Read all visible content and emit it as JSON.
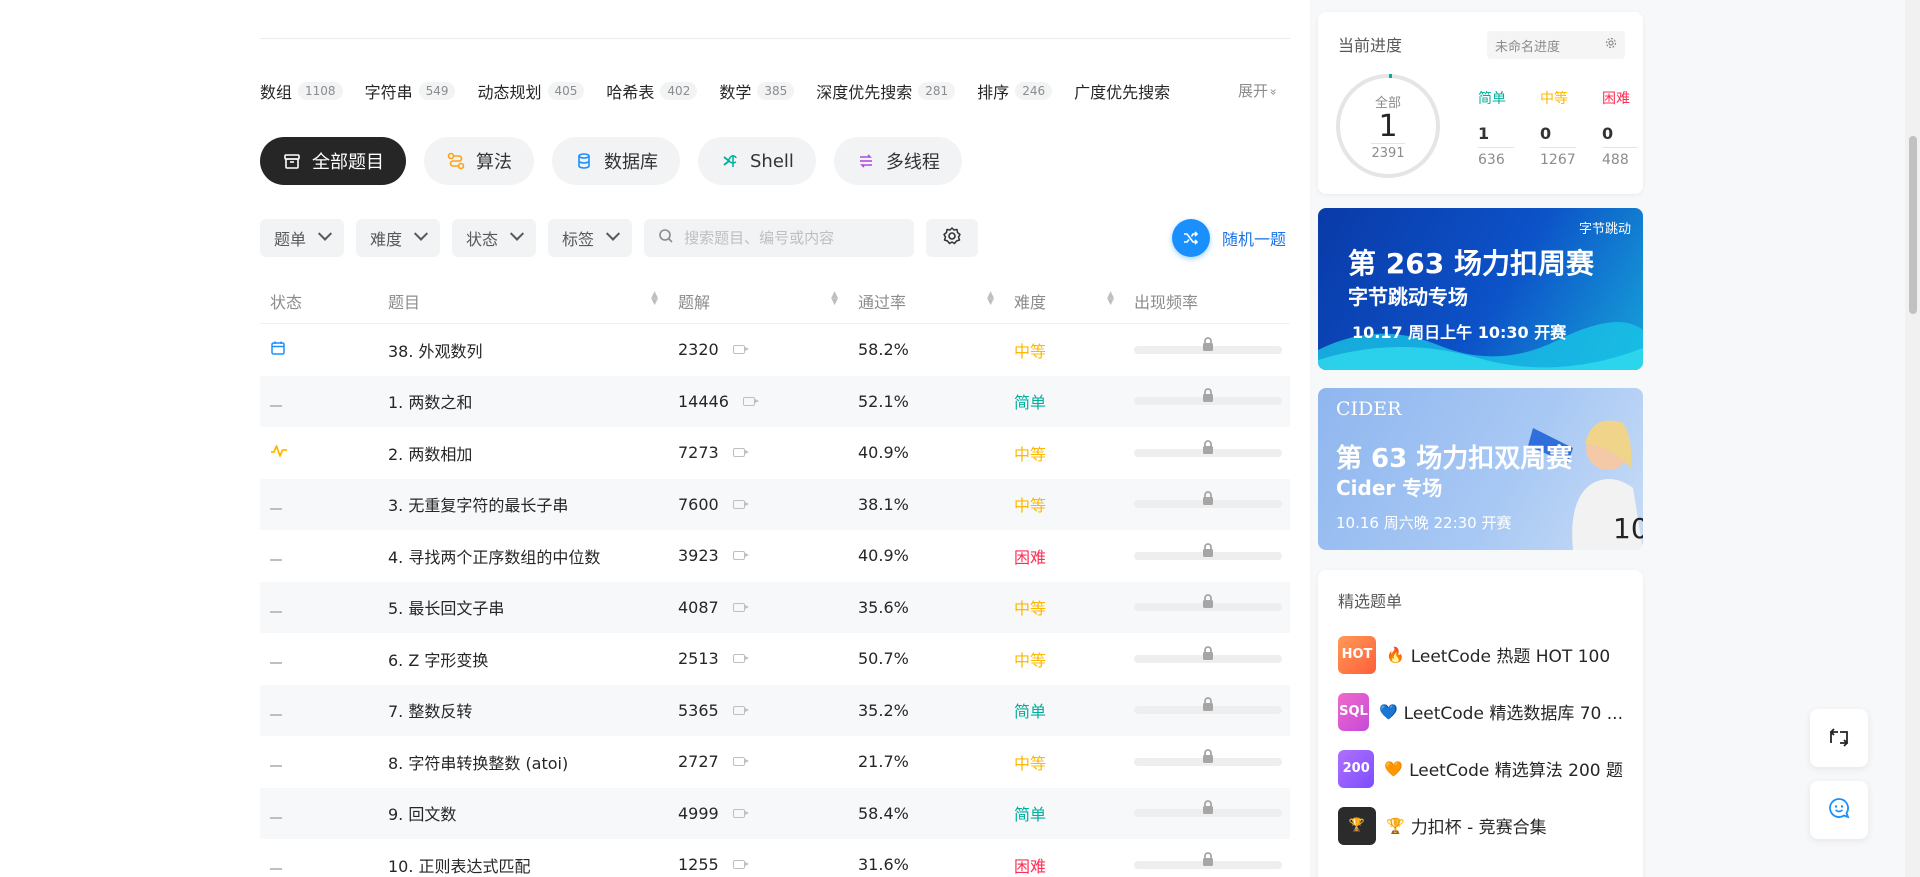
{
  "tags": [
    {
      "name": "数组",
      "count": "1108"
    },
    {
      "name": "字符串",
      "count": "549"
    },
    {
      "name": "动态规划",
      "count": "405"
    },
    {
      "name": "哈希表",
      "count": "402"
    },
    {
      "name": "数学",
      "count": "385"
    },
    {
      "name": "深度优先搜索",
      "count": "281"
    },
    {
      "name": "排序",
      "count": "246"
    }
  ],
  "tag_last": "广度优先搜索",
  "expand_label": "展开",
  "categories": [
    {
      "label": "全部题目",
      "icon": "archive-icon",
      "color": "#ffffff"
    },
    {
      "label": "算法",
      "icon": "algorithm-icon",
      "color": "#ffa116"
    },
    {
      "label": "数据库",
      "icon": "database-icon",
      "color": "#1a90ff"
    },
    {
      "label": "Shell",
      "icon": "shell-icon",
      "color": "#00af9b"
    },
    {
      "label": "多线程",
      "icon": "thread-icon",
      "color": "#b04ddb"
    }
  ],
  "filters": {
    "list": "题单",
    "difficulty": "难度",
    "status": "状态",
    "tags": "标签",
    "search_placeholder": "搜索题目、编号或内容",
    "random_label": "随机一题"
  },
  "columns": {
    "status": "状态",
    "title": "题目",
    "solutions": "题解",
    "acceptance": "通过率",
    "difficulty": "难度",
    "frequency": "出现频率"
  },
  "problems": [
    {
      "status": "calendar",
      "title": "38. 外观数列",
      "solutions": "2320",
      "rate": "58.2%",
      "difficulty": "中等",
      "level": "medium"
    },
    {
      "status": "none",
      "title": "1. 两数之和",
      "solutions": "14446",
      "rate": "52.1%",
      "difficulty": "简单",
      "level": "easy"
    },
    {
      "status": "attempted",
      "title": "2. 两数相加",
      "solutions": "7273",
      "rate": "40.9%",
      "difficulty": "中等",
      "level": "medium"
    },
    {
      "status": "none",
      "title": "3. 无重复字符的最长子串",
      "solutions": "7600",
      "rate": "38.1%",
      "difficulty": "中等",
      "level": "medium"
    },
    {
      "status": "none",
      "title": "4. 寻找两个正序数组的中位数",
      "solutions": "3923",
      "rate": "40.9%",
      "difficulty": "困难",
      "level": "hard"
    },
    {
      "status": "none",
      "title": "5. 最长回文子串",
      "solutions": "4087",
      "rate": "35.6%",
      "difficulty": "中等",
      "level": "medium"
    },
    {
      "status": "none",
      "title": "6. Z 字形变换",
      "solutions": "2513",
      "rate": "50.7%",
      "difficulty": "中等",
      "level": "medium"
    },
    {
      "status": "none",
      "title": "7. 整数反转",
      "solutions": "5365",
      "rate": "35.2%",
      "difficulty": "简单",
      "level": "easy"
    },
    {
      "status": "none",
      "title": "8. 字符串转换整数 (atoi)",
      "solutions": "2727",
      "rate": "21.7%",
      "difficulty": "中等",
      "level": "medium"
    },
    {
      "status": "none",
      "title": "9. 回文数",
      "solutions": "4999",
      "rate": "58.4%",
      "difficulty": "简单",
      "level": "easy"
    },
    {
      "status": "none",
      "title": "10. 正则表达式匹配",
      "solutions": "1255",
      "rate": "31.6%",
      "difficulty": "困难",
      "level": "hard"
    }
  ],
  "progress": {
    "title": "当前进度",
    "select_placeholder": "未命名进度",
    "ring_label": "全部",
    "solved": "1",
    "total": "2391",
    "stats": [
      {
        "label": "简单",
        "solved": "1",
        "total": "636",
        "color": "#00af9b"
      },
      {
        "label": "中等",
        "solved": "0",
        "total": "1267",
        "color": "#ffb800"
      },
      {
        "label": "困难",
        "solved": "0",
        "total": "488",
        "color": "#ff2d55"
      }
    ]
  },
  "banner_weekly": {
    "logo": "字节跳动",
    "line1": "第 263 场力扣周赛",
    "line2": "字节跳动专场",
    "line3": "10.17 周日上午 10:30 开赛"
  },
  "banner_biweekly": {
    "brand": "CIDER",
    "line1": "第 63 场力扣双周赛",
    "line2": "Cider 专场",
    "line3": "10.16 周六晚 22:30 开赛"
  },
  "featured": {
    "title": "精选题单",
    "items": [
      {
        "badge": "HOT",
        "emoji": "🔥",
        "label": "LeetCode 热题 HOT 100",
        "color": "#ff7a45"
      },
      {
        "badge": "SQL",
        "emoji": "💙",
        "label": "LeetCode 精选数据库 70 ...",
        "color": "#e056c8"
      },
      {
        "badge": "200",
        "emoji": "🧡",
        "label": "LeetCode 精选算法 200 题",
        "color": "#9b5cf6"
      },
      {
        "badge": "🏆",
        "emoji": "🏆",
        "label": "力扣杯 - 竞赛合集",
        "color": "#2b2b2b"
      }
    ]
  }
}
